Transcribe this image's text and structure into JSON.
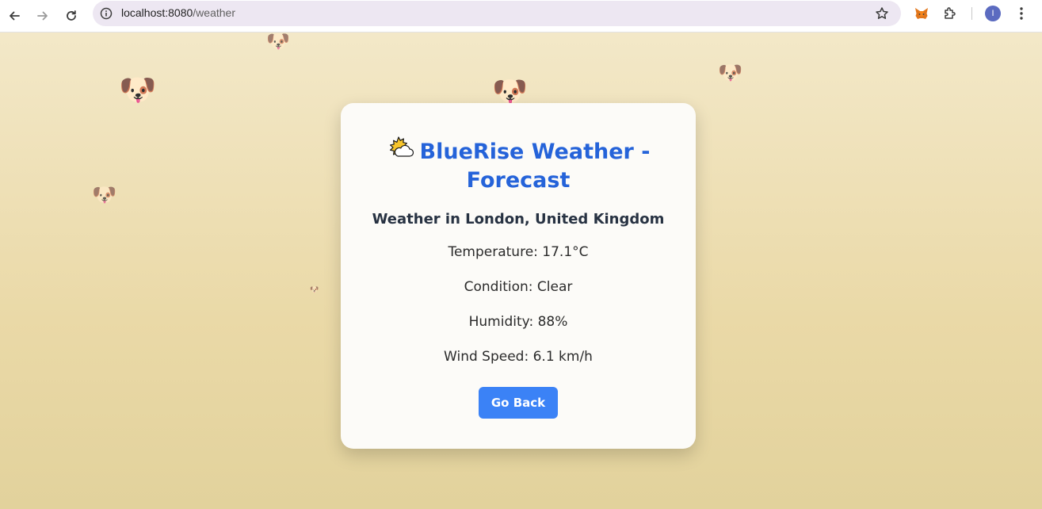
{
  "browser": {
    "url_host": "localhost:8080",
    "url_path": "/weather",
    "profile_initial": "I"
  },
  "card": {
    "title": "BlueRise Weather - Forecast",
    "title_icon": "sun-behind-cloud-icon",
    "subtitle": "Weather in London, United Kingdom",
    "stats": {
      "temperature": "Temperature: 17.1°C",
      "condition": "Condition: Clear",
      "humidity": "Humidity: 88%",
      "wind_speed": "Wind Speed: 6.1 km/h"
    },
    "back_button": "Go Back"
  },
  "decor": {
    "dog_glyph": "🐶",
    "accent": "#2563d9",
    "button_color": "#3b82f6",
    "background": "#ead9a7"
  }
}
